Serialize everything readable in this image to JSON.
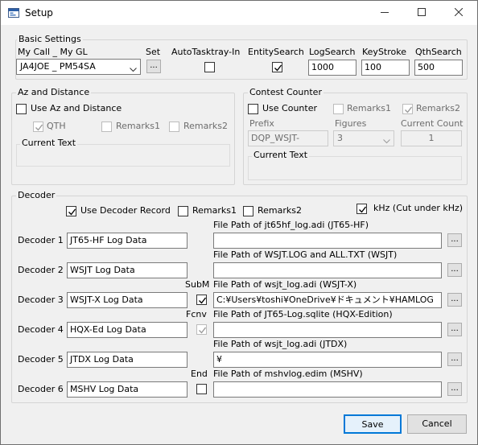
{
  "window": {
    "title": "Setup"
  },
  "basic": {
    "group_label": "Basic Settings",
    "mycall_label": "My Call _ My GL",
    "mycall_value": "JA4JOE _ PM54SA",
    "set_label": "Set",
    "set_button": "...",
    "autotasktray_label": "AutoTasktray-In",
    "autotasktray_checked": false,
    "entitysearch_label": "EntitySearch",
    "entitysearch_checked": true,
    "logsearch_label": "LogSearch",
    "logsearch_value": "1000",
    "keystroke_label": "KeyStroke",
    "keystroke_value": "100",
    "qthsearch_label": "QthSearch",
    "qthsearch_value": "500"
  },
  "az": {
    "group_label": "Az and Distance",
    "use_label": "Use Az and Distance",
    "use_checked": false,
    "qth_label": "QTH",
    "qth_checked": true,
    "remarks1_label": "Remarks1",
    "remarks2_label": "Remarks2",
    "current_text_label": "Current Text"
  },
  "contest": {
    "group_label": "Contest Counter",
    "use_label": "Use Counter",
    "use_checked": false,
    "remarks1_label": "Remarks1",
    "remarks2_label": "Remarks2",
    "remarks2_checked": true,
    "prefix_label": "Prefix",
    "prefix_value": "DQP_WSJT-",
    "figures_label": "Figures",
    "figures_value": "3",
    "current_count_label": "Current Count",
    "current_count_value": "1",
    "current_text_label": "Current Text"
  },
  "decoder": {
    "group_label": "Decoder",
    "use_record_label": "Use Decoder Record",
    "use_record_checked": true,
    "remarks1_label": "Remarks1",
    "remarks2_label": "Remarks2",
    "khz_label": "kHz (Cut under kHz)",
    "khz_checked": true,
    "browse_label": "...",
    "rows": [
      {
        "label": "Decoder 1",
        "name": "JT65-HF Log Data",
        "path_label": "File Path of jt65hf_log.adi (JT65-HF)",
        "path": "",
        "opt_label": "",
        "opt_checked": null
      },
      {
        "label": "Decoder 2",
        "name": "WSJT Log Data",
        "path_label": "File Path of WSJT.LOG and ALL.TXT (WSJT)",
        "path": "",
        "opt_label": "",
        "opt_checked": null
      },
      {
        "label": "Decoder 3",
        "name": "WSJT-X Log Data",
        "path_label": "File Path of wsjt_log.adi (WSJT-X)",
        "path": "C:¥Users¥toshi¥OneDrive¥ドキュメント¥HAMLOG",
        "opt_label": "SubM",
        "opt_checked": true
      },
      {
        "label": "Decoder 4",
        "name": "HQX-Ed Log Data",
        "path_label": "File Path of JT65-Log.sqlite (HQX-Edition)",
        "path": "",
        "opt_label": "Fcnv",
        "opt_checked": true
      },
      {
        "label": "Decoder 5",
        "name": "JTDX Log Data",
        "path_label": "File Path of wsjt_log.adi (JTDX)",
        "path": "¥",
        "opt_label": "",
        "opt_checked": null
      },
      {
        "label": "Decoder 6",
        "name": "MSHV Log Data",
        "path_label": "File Path of mshvlog.edim (MSHV)",
        "path": "",
        "opt_label": "End",
        "opt_checked": false
      }
    ]
  },
  "buttons": {
    "save": "Save",
    "cancel": "Cancel"
  },
  "icons": {
    "app": "setup-app-icon",
    "minimize": "minimize-icon",
    "maximize": "maximize-icon",
    "close": "close-icon",
    "check": "checkmark-icon",
    "dropdown": "chevron-down-icon"
  }
}
